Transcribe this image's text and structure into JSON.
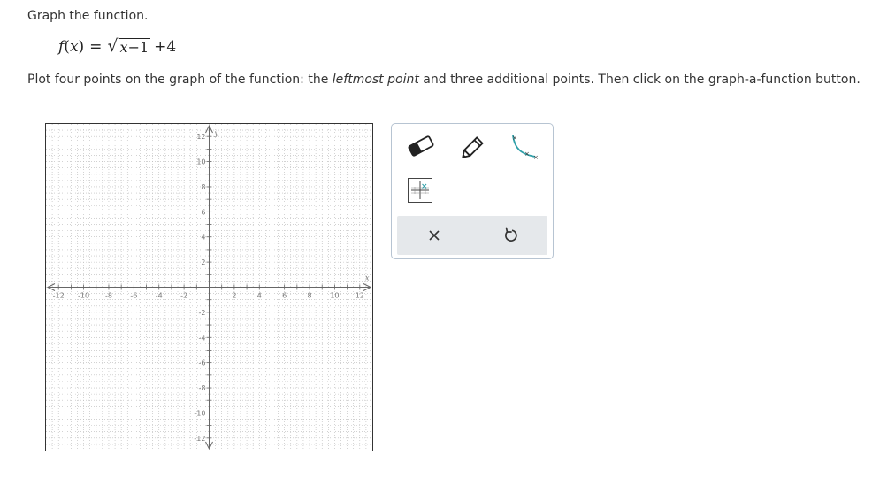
{
  "prompt": "Graph the function.",
  "formula": {
    "lhs": "f",
    "lparen": "(",
    "arg": "x",
    "rparen": ")",
    "equals": "=",
    "radical": "√",
    "radicand_var": "x",
    "radicand_rest": "−1",
    "plus": "+4"
  },
  "instructions": {
    "part1": "Plot four points on the graph of the function: the ",
    "emphasis": "leftmost point",
    "part2": " and three additional points. Then click on the graph-a-function button."
  },
  "graph": {
    "x_axis_label": "x",
    "y_axis_label": "y",
    "x_range": [
      -13,
      13
    ],
    "y_range": [
      -13,
      13
    ],
    "tick_labels": [
      -12,
      -10,
      -8,
      -6,
      -4,
      -2,
      2,
      4,
      6,
      8,
      10,
      12
    ]
  },
  "tools": {
    "eraser": "eraser-icon",
    "pencil": "pencil-icon",
    "graph_function": "graph-function-icon",
    "grid": "grid-points-icon"
  },
  "actions": {
    "clear": "×",
    "undo": "undo-icon"
  },
  "colors": {
    "accent": "#2f9fa8",
    "panel_border": "#b7c4d2",
    "action_bar": "#e5e8eb",
    "grid_line": "#b8b8b8"
  }
}
